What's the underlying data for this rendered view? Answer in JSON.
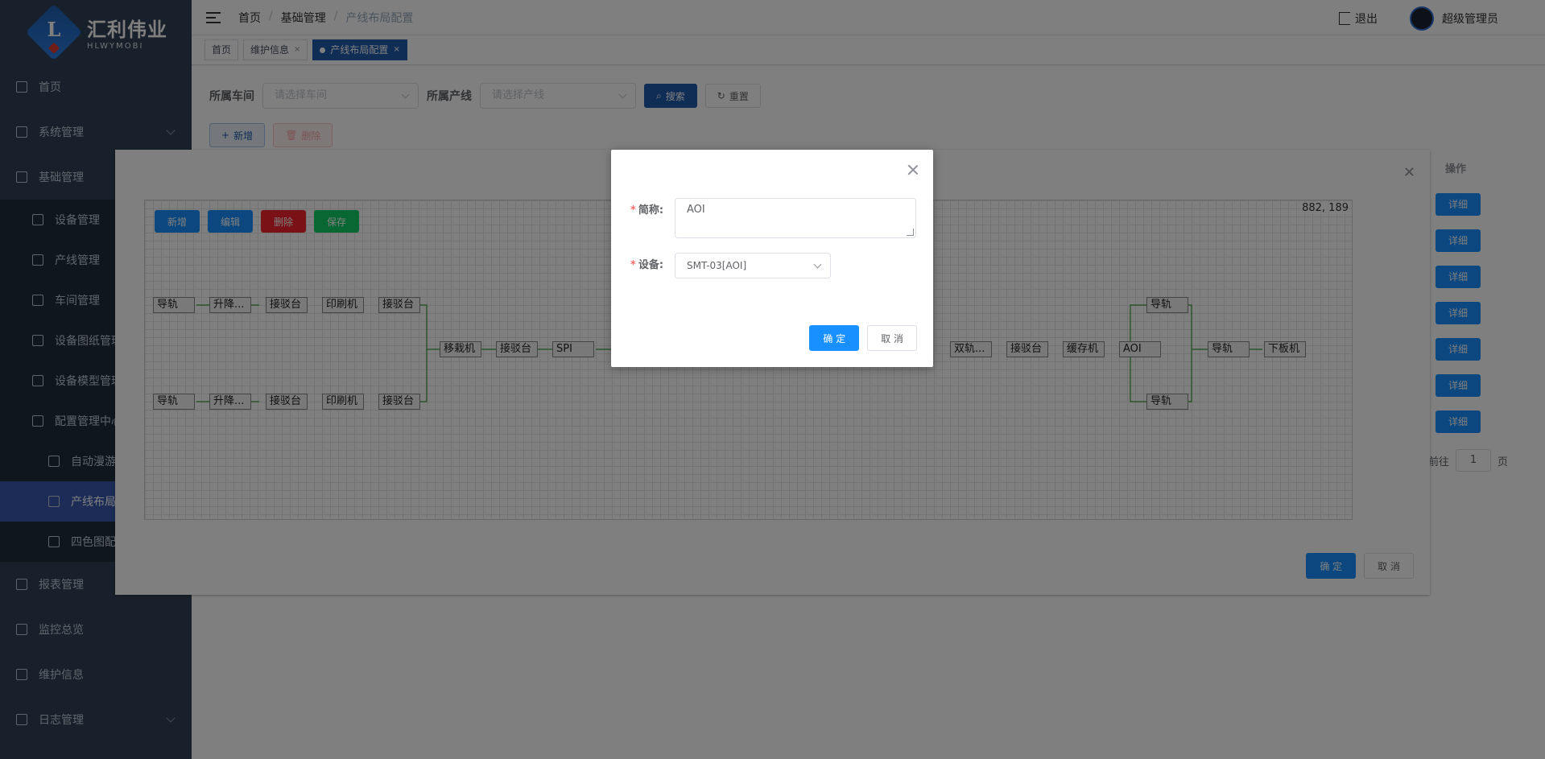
{
  "brand": {
    "name_cn": "汇利伟业",
    "name_en": "HLWYMOBI"
  },
  "sidebar": {
    "items": [
      {
        "label": "首页"
      },
      {
        "label": "系统管理"
      },
      {
        "label": "基础管理"
      },
      {
        "label": "设备管理"
      },
      {
        "label": "产线管理"
      },
      {
        "label": "车间管理"
      },
      {
        "label": "设备图纸管理"
      },
      {
        "label": "设备模型管理"
      },
      {
        "label": "配置管理中心"
      },
      {
        "label": "自动漫游"
      },
      {
        "label": "产线布局"
      },
      {
        "label": "四色图配"
      },
      {
        "label": "报表管理"
      },
      {
        "label": "监控总览"
      },
      {
        "label": "维护信息"
      },
      {
        "label": "日志管理"
      }
    ]
  },
  "header": {
    "breadcrumb": [
      "首页",
      "基础管理",
      "产线布局配置"
    ],
    "logout": "退出",
    "user": "超级管理员"
  },
  "tags": [
    {
      "label": "首页"
    },
    {
      "label": "维护信息"
    },
    {
      "label": "产线布局配置"
    }
  ],
  "filter": {
    "workshop_label": "所属车间",
    "workshop_placeholder": "请选择车间",
    "line_label": "所属产线",
    "line_placeholder": "请选择产线",
    "search": "搜索",
    "reset": "重置"
  },
  "toolbar": {
    "add": "新增",
    "delete": "删除"
  },
  "table": {
    "ops_header": "操作",
    "detail_label": "详细",
    "rows": 7
  },
  "pagination": {
    "goto": "前往",
    "page": "1",
    "page_suffix": "页"
  },
  "layout_dialog": {
    "buttons": {
      "add": "新增",
      "edit": "编辑",
      "delete": "删除",
      "save": "保存"
    },
    "coords": "882, 189",
    "nodes": [
      "导轨",
      "升降...",
      "接驳台",
      "印刷机",
      "接驳台",
      "导轨",
      "升降...",
      "接驳台",
      "印刷机",
      "接驳台",
      "移栽机",
      "接驳台",
      "SPI",
      "双轨...",
      "接驳台",
      "缓存机",
      "AOI",
      "导轨",
      "导轨",
      "导轨",
      "下板机"
    ],
    "confirm": "确 定",
    "cancel": "取 消"
  },
  "edit_dialog": {
    "name_label": "简称:",
    "name_value": "AOI",
    "device_label": "设备:",
    "device_value": "SMT-03[AOI]",
    "confirm": "确 定",
    "cancel": "取 消"
  }
}
